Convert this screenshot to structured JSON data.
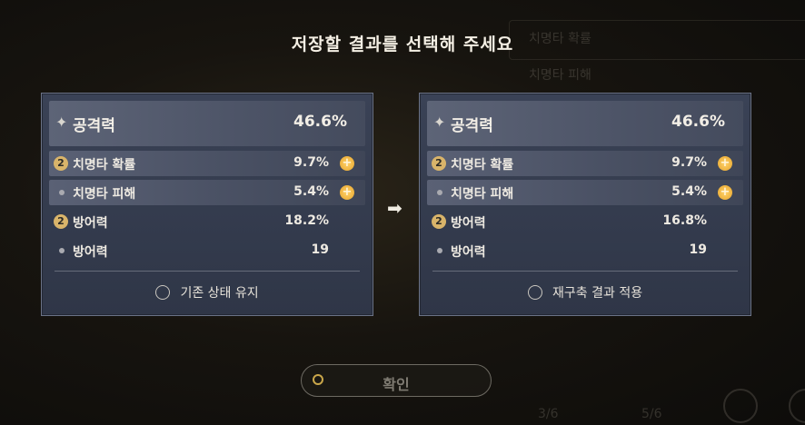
{
  "screen": {
    "title": "저장할 결과를 선택해 주세요"
  },
  "left_panel": {
    "main_stat": {
      "icon": "sparkle-icon",
      "name": "공격력",
      "value": "46.6%"
    },
    "sub_stats": [
      {
        "marker": "2",
        "name": "치명타 확률",
        "value": "9.7%",
        "boosted": true,
        "highlighted": true
      },
      {
        "marker": "dot",
        "name": "치명타 피해",
        "value": "5.4%",
        "boosted": true,
        "highlighted": true
      },
      {
        "marker": "2",
        "name": "방어력",
        "value": "18.2%",
        "boosted": false,
        "highlighted": false
      },
      {
        "marker": "dot",
        "name": "방어력",
        "value": "19",
        "boosted": false,
        "highlighted": false
      }
    ],
    "choice_label": "기존 상태 유지",
    "selected": false
  },
  "right_panel": {
    "main_stat": {
      "icon": "sparkle-icon",
      "name": "공격력",
      "value": "46.6%"
    },
    "sub_stats": [
      {
        "marker": "2",
        "name": "치명타 확률",
        "value": "9.7%",
        "boosted": true,
        "highlighted": true
      },
      {
        "marker": "dot",
        "name": "치명타 피해",
        "value": "5.4%",
        "boosted": true,
        "highlighted": true
      },
      {
        "marker": "2",
        "name": "방어력",
        "value": "16.8%",
        "boosted": false,
        "highlighted": false
      },
      {
        "marker": "dot",
        "name": "방어력",
        "value": "19",
        "boosted": false,
        "highlighted": false
      }
    ],
    "choice_label": "재구축 결과 적용",
    "selected": false
  },
  "arrow_icon": "arrow-right-icon",
  "confirm_button": {
    "label": "확인",
    "enabled": false
  },
  "background_ghost": {
    "rows": [
      "치명타 확률",
      "치명타 피해"
    ],
    "counters": [
      "3/6",
      "5/6"
    ]
  },
  "colors": {
    "badge": "#d9b46a",
    "plus": "#e7a42b",
    "panel": "#343b4d"
  }
}
